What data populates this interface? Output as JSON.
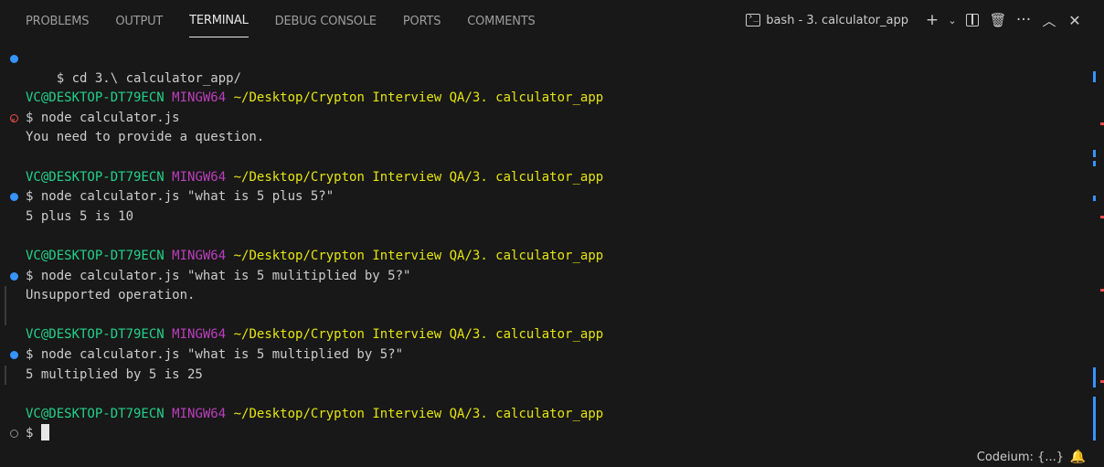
{
  "panel": {
    "tabs": [
      {
        "label": "PROBLEMS"
      },
      {
        "label": "OUTPUT"
      },
      {
        "label": "TERMINAL"
      },
      {
        "label": "DEBUG CONSOLE"
      },
      {
        "label": "PORTS"
      },
      {
        "label": "COMMENTS"
      }
    ],
    "active_tab": "TERMINAL",
    "shell_label": "bash - 3. calculator_app"
  },
  "terminal": {
    "cd_command": "$ cd 3.\\ calculator_app/",
    "blocks": [
      {
        "user": "VC@DESKTOP-DT79ECN",
        "host": "MINGW64",
        "path": "~/Desktop/Crypton Interview QA/3. calculator_app",
        "status": "error",
        "command": "$ node calculator.js",
        "output": "You need to provide a question."
      },
      {
        "user": "VC@DESKTOP-DT79ECN",
        "host": "MINGW64",
        "path": "~/Desktop/Crypton Interview QA/3. calculator_app",
        "status": "success",
        "command": "$ node calculator.js \"what is 5 plus 5?\"",
        "output": "5 plus 5 is 10"
      },
      {
        "user": "VC@DESKTOP-DT79ECN",
        "host": "MINGW64",
        "path": "~/Desktop/Crypton Interview QA/3. calculator_app",
        "status": "success",
        "command": "$ node calculator.js \"what is 5 mulitiplied by 5?\"",
        "output": "Unsupported operation."
      },
      {
        "user": "VC@DESKTOP-DT79ECN",
        "host": "MINGW64",
        "path": "~/Desktop/Crypton Interview QA/3. calculator_app",
        "status": "success",
        "command": "$ node calculator.js \"what is 5 multiplied by 5?\"",
        "output": "5 multiplied by 5 is 25"
      }
    ],
    "final_prompt": {
      "user": "VC@DESKTOP-DT79ECN",
      "host": "MINGW64",
      "path": "~/Desktop/Crypton Interview QA/3. calculator_app",
      "input": "$ "
    }
  },
  "statusbar": {
    "codeium": "Codeium: {...}"
  },
  "colors": {
    "background": "#181818",
    "user": "#23d18b",
    "host": "#bc3fbc",
    "path": "#e5e510",
    "success_dot": "#3794ff",
    "error_dot": "#f14c4c"
  }
}
